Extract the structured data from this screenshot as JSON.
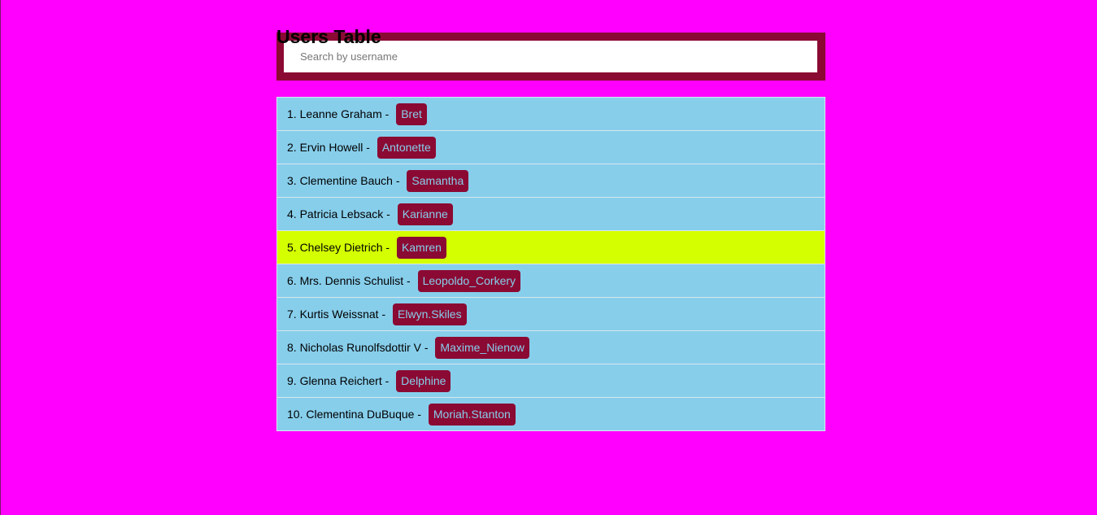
{
  "page": {
    "title": "Users Table"
  },
  "search": {
    "placeholder": "Search by username",
    "value": ""
  },
  "colors": {
    "background": "#ff00ff",
    "search_frame": "#8b0a33",
    "row_background": "#87ceeb",
    "row_highlight": "#d4ff00",
    "badge_background": "#8b0a33",
    "badge_text": "#87ceeb"
  },
  "users": [
    {
      "label": "1. Leanne Graham - ",
      "username": "Bret",
      "highlighted": false
    },
    {
      "label": "2. Ervin Howell - ",
      "username": "Antonette",
      "highlighted": false
    },
    {
      "label": "3. Clementine Bauch - ",
      "username": "Samantha",
      "highlighted": false
    },
    {
      "label": "4. Patricia Lebsack - ",
      "username": "Karianne",
      "highlighted": false
    },
    {
      "label": "5. Chelsey Dietrich - ",
      "username": "Kamren",
      "highlighted": true
    },
    {
      "label": "6. Mrs. Dennis Schulist - ",
      "username": "Leopoldo_Corkery",
      "highlighted": false
    },
    {
      "label": "7. Kurtis Weissnat - ",
      "username": "Elwyn.Skiles",
      "highlighted": false
    },
    {
      "label": "8. Nicholas Runolfsdottir V - ",
      "username": "Maxime_Nienow",
      "highlighted": false
    },
    {
      "label": "9. Glenna Reichert - ",
      "username": "Delphine",
      "highlighted": false
    },
    {
      "label": "10. Clementina DuBuque - ",
      "username": "Moriah.Stanton",
      "highlighted": false
    }
  ]
}
